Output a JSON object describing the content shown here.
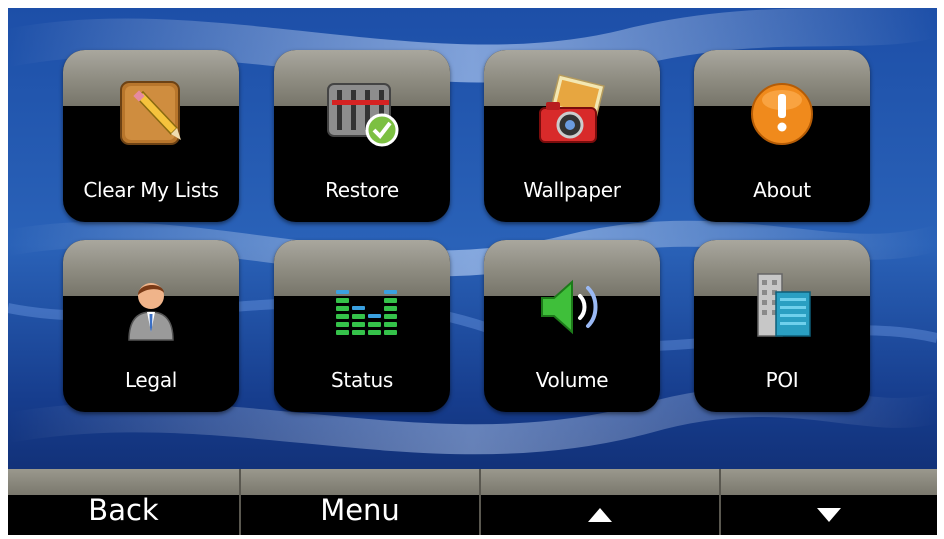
{
  "tiles": [
    {
      "label": "Clear My Lists",
      "icon": "pencil-note-icon"
    },
    {
      "label": "Restore",
      "icon": "equalizer-restore-icon"
    },
    {
      "label": "Wallpaper",
      "icon": "camera-photos-icon"
    },
    {
      "label": "About",
      "icon": "exclamation-icon"
    },
    {
      "label": "Legal",
      "icon": "person-icon"
    },
    {
      "label": "Status",
      "icon": "status-bars-icon"
    },
    {
      "label": "Volume",
      "icon": "speaker-icon"
    },
    {
      "label": "POI",
      "icon": "building-icon"
    }
  ],
  "bottom_bar": {
    "back_label": "Back",
    "menu_label": "Menu",
    "up_icon": "up-arrow-icon",
    "down_icon": "down-arrow-icon"
  },
  "colors": {
    "background": "#1e4aa0",
    "tile": "#000000",
    "tile_cap": "#8d8b80",
    "label": "#ffffff"
  }
}
